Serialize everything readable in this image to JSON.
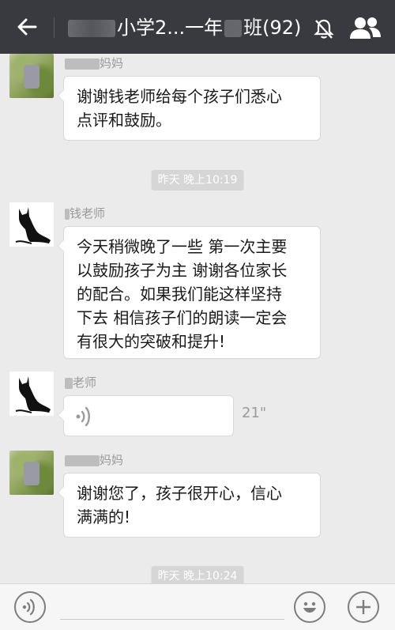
{
  "header": {
    "title_visible": "小学2...一年",
    "title_mid": "班(92)",
    "icons": [
      "back-arrow-icon",
      "mute-bell-icon",
      "group-members-icon"
    ]
  },
  "messages": [
    {
      "sender_suffix": "妈妈",
      "text": "谢谢钱老师给每个孩子们悉心点评和鼓励。",
      "avatar": "photo"
    },
    {
      "type": "timestamp",
      "text": "昨天 晚上10:19"
    },
    {
      "sender_suffix": "钱老师",
      "text": "今天稍微晚了一些 第一次主要以鼓励孩子为主 谢谢各位家长的配合。如果我们能这样坚持下去 相信孩子们的朗读一定会有很大的突破和提升!",
      "avatar": "cat"
    },
    {
      "sender_suffix": "老师",
      "type": "voice",
      "duration": "21\"",
      "avatar": "cat"
    },
    {
      "sender_suffix": "妈妈",
      "text": "谢谢您了，孩子很开心，信心满满的!",
      "avatar": "photo"
    },
    {
      "type": "timestamp",
      "text": "昨天 晚上10:24"
    }
  ],
  "msg1": {
    "nick": "妈妈",
    "lines": [
      "谢谢钱老师给每个孩子们悉心",
      "点评和鼓励。"
    ]
  },
  "ts1": "昨天 晚上10:19",
  "msg2": {
    "nick": "钱老师",
    "lines": [
      "今天稍微晚了一些 第一次主要",
      "以鼓励孩子为主 谢谢各位家长",
      "的配合。如果我们能这样坚持",
      "下去 相信孩子们的朗读一定会",
      "有很大的突破和提升!"
    ]
  },
  "msg3": {
    "nick": "老师",
    "duration": "21\""
  },
  "msg4": {
    "nick": "妈妈",
    "lines": [
      "谢谢您了，孩子很开心，信心",
      "满满的!"
    ]
  },
  "ts2": "昨天 晚上10:24",
  "input": {
    "placeholder": ""
  },
  "colors": {
    "header_bg": "#393a3f",
    "chat_bg": "#ebebeb",
    "bubble": "#ffffff"
  }
}
